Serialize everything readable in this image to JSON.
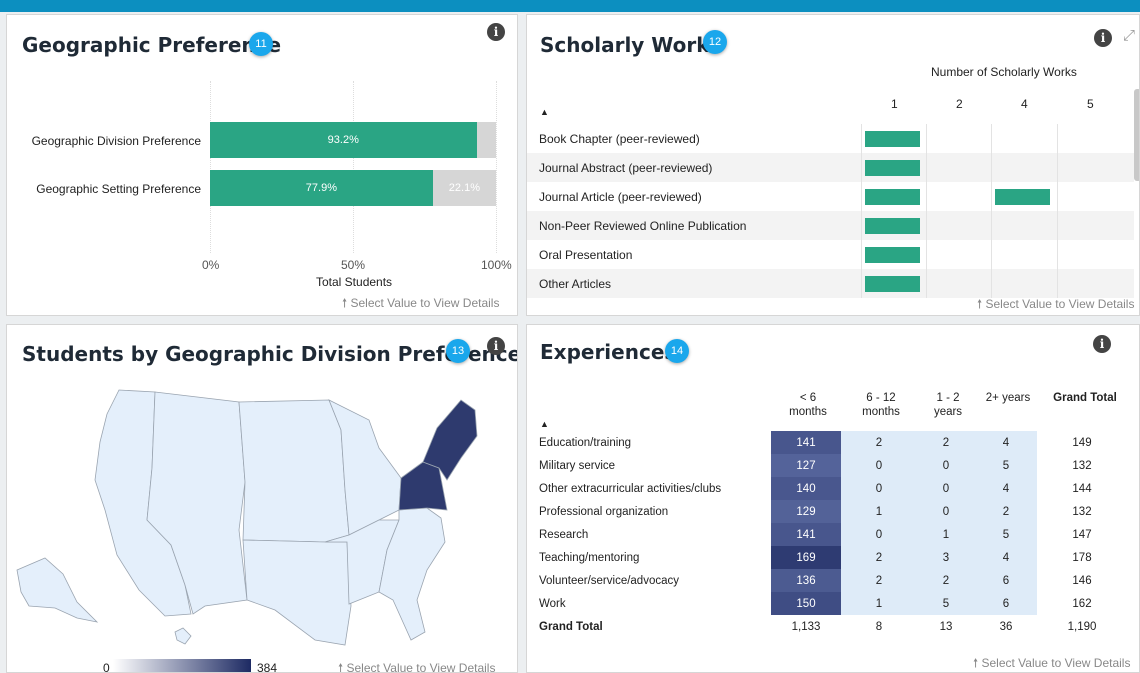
{
  "colors": {
    "topbar": "#0c8fc0",
    "teal": "#2aa584",
    "gray": "#d6d6d6",
    "navy": "#2e3a6e",
    "badge": "#1aa7ec"
  },
  "footer_text": "Select Value to View Details",
  "geo_pref": {
    "title": "Geographic Preference",
    "badge": "11",
    "info_icon": "i",
    "chart_data": {
      "type": "bar",
      "orientation": "horizontal",
      "stacked": true,
      "categories": [
        "Geographic Division Preference",
        "Geographic Setting Preference"
      ],
      "series": [
        {
          "values": [
            93.2,
            77.9
          ],
          "labels": [
            "93.2%",
            "77.9%"
          ]
        },
        {
          "values": [
            6.8,
            22.1
          ],
          "labels": [
            "",
            "22.1%"
          ]
        }
      ],
      "xlabel": "Total Students",
      "xticks": [
        "0%",
        "50%",
        "100%"
      ],
      "xlim": [
        0,
        100
      ]
    }
  },
  "scholarly": {
    "title": "Scholarly Works",
    "badge": "12",
    "info_icon": "i",
    "expand_icon": "⤢",
    "header": "Number of Scholarly Works",
    "sort_icon": "▲",
    "columns": [
      "1",
      "2",
      "4",
      "5"
    ],
    "rows": [
      {
        "label": "Book Chapter (peer-reviewed)",
        "bars": [
          1,
          0,
          0,
          0
        ]
      },
      {
        "label": "Journal Abstract (peer-reviewed)",
        "bars": [
          1,
          0,
          0,
          0
        ]
      },
      {
        "label": "Journal Article (peer-reviewed)",
        "bars": [
          1,
          0,
          1,
          0
        ]
      },
      {
        "label": "Non-Peer Reviewed Online Publication",
        "bars": [
          1,
          0,
          0,
          0
        ]
      },
      {
        "label": "Oral Presentation",
        "bars": [
          1,
          0,
          0,
          0
        ]
      },
      {
        "label": "Other Articles",
        "bars": [
          1,
          0,
          0,
          0
        ]
      }
    ]
  },
  "map": {
    "title": "Students by Geographic Division Preference",
    "badge": "13",
    "info_icon": "i",
    "legend_min": "0",
    "legend_max": "384",
    "highlighted_region": "New England"
  },
  "experiences": {
    "title": "Experiences",
    "badge": "14",
    "info_icon": "i",
    "sort_icon": "▲",
    "columns": [
      {
        "line1": "< 6",
        "line2": "months"
      },
      {
        "line1": "6 - 12",
        "line2": "months"
      },
      {
        "line1": "1 - 2",
        "line2": "years"
      },
      {
        "line1": "2+ years",
        "line2": ""
      },
      {
        "line1": "Grand Total",
        "line2": ""
      }
    ],
    "rows": [
      {
        "label": "Education/training",
        "values": [
          "141",
          "2",
          "2",
          "4",
          "149"
        ]
      },
      {
        "label": "Military service",
        "values": [
          "127",
          "0",
          "0",
          "5",
          "132"
        ]
      },
      {
        "label": "Other extracurricular activities/clubs",
        "values": [
          "140",
          "0",
          "0",
          "4",
          "144"
        ]
      },
      {
        "label": "Professional organization",
        "values": [
          "129",
          "1",
          "0",
          "2",
          "132"
        ]
      },
      {
        "label": "Research",
        "values": [
          "141",
          "0",
          "1",
          "5",
          "147"
        ]
      },
      {
        "label": "Teaching/mentoring",
        "values": [
          "169",
          "2",
          "3",
          "4",
          "178"
        ]
      },
      {
        "label": "Volunteer/service/advocacy",
        "values": [
          "136",
          "2",
          "2",
          "6",
          "146"
        ]
      },
      {
        "label": "Work",
        "values": [
          "150",
          "1",
          "5",
          "6",
          "162"
        ]
      }
    ],
    "total_row": {
      "label": "Grand Total",
      "values": [
        "1,133",
        "8",
        "13",
        "36",
        "1,190"
      ]
    }
  }
}
